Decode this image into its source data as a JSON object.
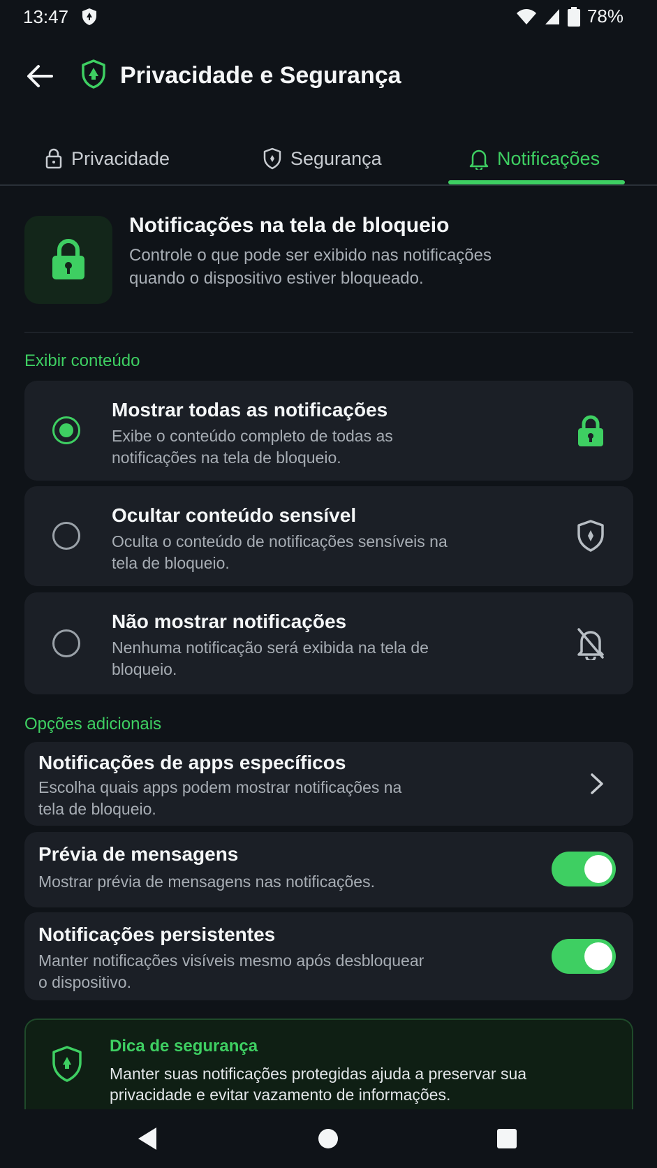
{
  "status_bar": {
    "time": "13:47",
    "battery": "78%"
  },
  "app_bar": {
    "title": "Privacidade e Segurança"
  },
  "tabs": [
    {
      "label": "Privacidade",
      "icon": "lock-icon",
      "active": false
    },
    {
      "label": "Segurança",
      "icon": "shield-icon",
      "active": false
    },
    {
      "label": "Notificações",
      "icon": "bell-icon",
      "active": true
    }
  ],
  "header": {
    "title": "Notificações na tela de bloqueio",
    "description": "Controle o que pode ser exibido nas notificações quando o dispositivo estiver bloqueado."
  },
  "display_section": {
    "label": "Exibir conteúdo",
    "options": [
      {
        "title": "Mostrar todas as notificações",
        "description": "Exibe o conteúdo completo de todas as notificações na tela de bloqueio.",
        "selected": true,
        "icon": "lock-icon"
      },
      {
        "title": "Ocultar conteúdo sensível",
        "description": "Oculta o conteúdo de notificações sensíveis na tela de bloqueio.",
        "selected": false,
        "icon": "shield-icon"
      },
      {
        "title": "Não mostrar notificações",
        "description": "Nenhuma notificação será exibida na tela de bloqueio.",
        "selected": false,
        "icon": "bell-off-icon"
      }
    ]
  },
  "additional_section": {
    "label": "Opções adicionais",
    "items": [
      {
        "title": "Notificações de apps específicos",
        "description": "Escolha quais apps podem mostrar notificações na tela de bloqueio."
      },
      {
        "title": "Prévia de mensagens",
        "description": "Mostrar prévia de mensagens nas notificações.",
        "enabled": true
      },
      {
        "title": "Notificações persistentes",
        "description": "Manter notificações visíveis mesmo após desbloquear o dispositivo.",
        "enabled": true
      }
    ]
  },
  "tip": {
    "title": "Dica de segurança",
    "description": "Manter suas notificações protegidas ajuda a preservar sua privacidade e evitar vazamento de informações."
  },
  "colors": {
    "accent": "#3ecf62",
    "background": "#0f1318",
    "card": "#1b1f26"
  }
}
